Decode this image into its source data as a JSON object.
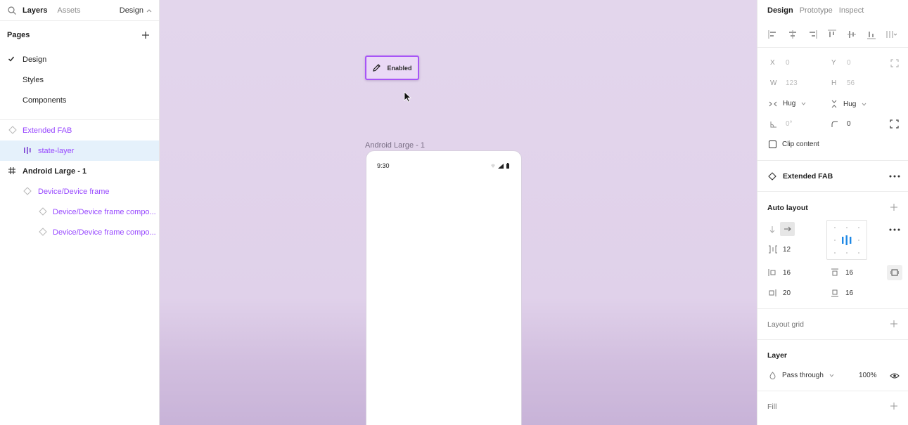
{
  "left": {
    "tabs": [
      "Layers",
      "Assets"
    ],
    "page_switch": "Design",
    "pages_title": "Pages",
    "pages": [
      "Design",
      "Styles",
      "Components"
    ],
    "layers": [
      {
        "label": "Extended FAB"
      },
      {
        "label": "state-layer"
      },
      {
        "label": "Android Large - 1"
      },
      {
        "label": "Device/Device frame"
      },
      {
        "label": "Device/Device frame compo..."
      },
      {
        "label": "Device/Device frame compo..."
      }
    ]
  },
  "canvas": {
    "fab_label": "Enabled",
    "frame_label": "Android Large - 1",
    "phone_time": "9:30"
  },
  "right": {
    "tabs": [
      "Design",
      "Prototype",
      "Inspect"
    ],
    "x_label": "X",
    "x_value": "0",
    "y_label": "Y",
    "y_value": "0",
    "w_label": "W",
    "w_value": "123",
    "h_label": "H",
    "h_value": "56",
    "w_sizing": "Hug",
    "h_sizing": "Hug",
    "rotation": "0°",
    "radius": "0",
    "clip_content": "Clip content",
    "component_name": "Extended FAB",
    "auto_layout_title": "Auto layout",
    "gap": "12",
    "pad_left": "16",
    "pad_top": "16",
    "pad_right": "20",
    "pad_bottom": "16",
    "layout_grid_title": "Layout grid",
    "layer_title": "Layer",
    "blend_mode": "Pass through",
    "opacity": "100%",
    "fill_title": "Fill"
  }
}
